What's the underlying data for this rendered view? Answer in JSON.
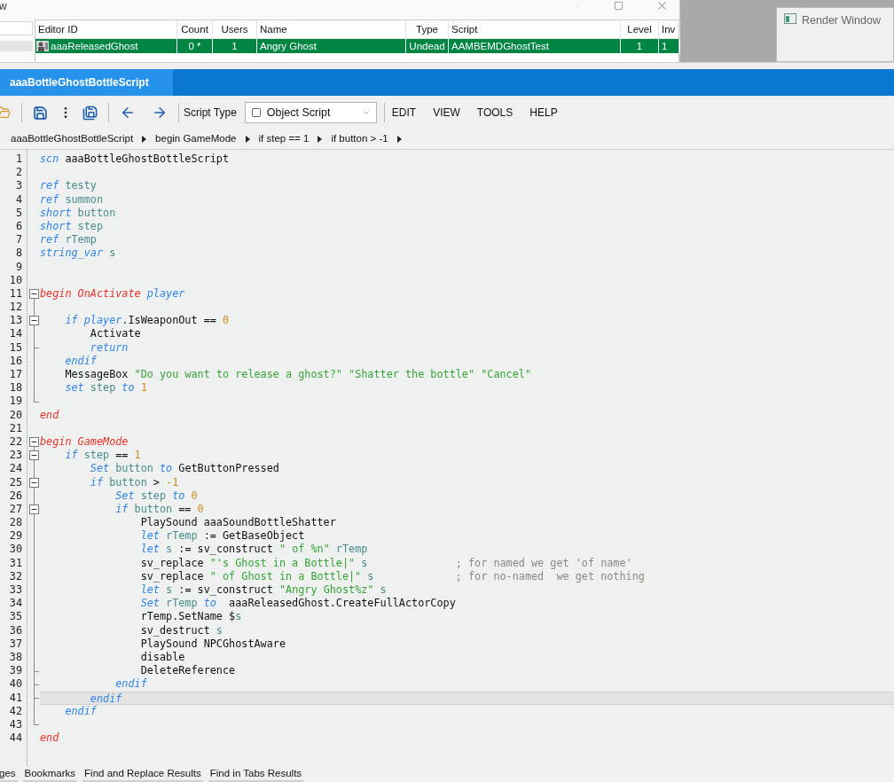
{
  "background_window": {
    "title": "w",
    "columns": [
      "Editor ID",
      "Count",
      "Users",
      "Name",
      "Type",
      "Script",
      "Level",
      "Inv"
    ],
    "rows": [
      {
        "selected": true,
        "cells": [
          "aaaReleasedGhost",
          "0 *",
          "1",
          "Angry Ghost",
          "Undead",
          "AAMBEMDGhostTest",
          "1",
          "1"
        ]
      }
    ]
  },
  "render_window": {
    "title": "Render Window"
  },
  "editor": {
    "tabs": [
      {
        "label": "aaaBottleGhostBottleScript",
        "selected": true
      }
    ],
    "toolbar": {
      "script_type_label": "Script Type",
      "script_type": "Object Script",
      "menus": [
        "EDIT",
        "VIEW",
        "TOOLS",
        "HELP"
      ]
    },
    "breadcrumb": [
      "aaaBottleGhostBottleScript",
      "begin GameMode",
      "if step == 1",
      "if button > -1"
    ],
    "lines": [
      {
        "number": "1",
        "kind": "none",
        "current": false,
        "tokens": [
          {
            "kind": "keyword",
            "text": "scn"
          },
          {
            "kind": "text",
            "text": " aaaBottleGhostBottleScript"
          }
        ]
      },
      {
        "number": "2",
        "kind": "none",
        "current": false
      },
      {
        "number": "3",
        "kind": "none",
        "current": false,
        "tokens": [
          {
            "kind": "keyword",
            "text": "ref"
          },
          {
            "kind": "variable",
            "text": " testy"
          }
        ]
      },
      {
        "number": "4",
        "kind": "none",
        "current": false,
        "tokens": [
          {
            "kind": "keyword",
            "text": "ref"
          },
          {
            "kind": "variable",
            "text": " summon"
          }
        ]
      },
      {
        "number": "5",
        "kind": "none",
        "current": false,
        "tokens": [
          {
            "kind": "keyword",
            "text": "short"
          },
          {
            "kind": "variable",
            "text": " button"
          }
        ]
      },
      {
        "number": "6",
        "kind": "none",
        "current": false,
        "tokens": [
          {
            "kind": "keyword",
            "text": "short"
          },
          {
            "kind": "variable",
            "text": " step"
          }
        ]
      },
      {
        "number": "7",
        "kind": "none",
        "current": false,
        "tokens": [
          {
            "kind": "keyword",
            "text": "ref"
          },
          {
            "kind": "variable",
            "text": " rTemp"
          }
        ]
      },
      {
        "number": "8",
        "kind": "none",
        "current": false,
        "tokens": [
          {
            "kind": "keyword",
            "text": "string_var"
          },
          {
            "kind": "variable",
            "text": " s"
          }
        ]
      },
      {
        "number": "9",
        "kind": "none",
        "current": false
      },
      {
        "number": "10",
        "kind": "none",
        "current": false
      },
      {
        "number": "11",
        "kind": "start",
        "current": false,
        "tokens": [
          {
            "kind": "block",
            "text": "begin OnActivate"
          },
          {
            "kind": "keyword",
            "text": " player"
          }
        ]
      },
      {
        "number": "12",
        "kind": "inner",
        "current": false
      },
      {
        "number": "13",
        "kind": "open",
        "current": false,
        "tokens": [
          {
            "kind": "keyword",
            "text": "    if player"
          },
          {
            "kind": "text",
            "text": ".IsWeaponOut == "
          },
          {
            "kind": "number",
            "text": "0"
          }
        ]
      },
      {
        "number": "14",
        "kind": "inner",
        "current": false,
        "tokens": [
          {
            "kind": "text",
            "text": "        Activate"
          }
        ]
      },
      {
        "number": "15",
        "kind": "branch",
        "current": false,
        "tokens": [
          {
            "kind": "keyword",
            "text": "        return"
          }
        ]
      },
      {
        "number": "16",
        "kind": "inner",
        "current": false,
        "tokens": [
          {
            "kind": "keyword",
            "text": "    endif"
          }
        ]
      },
      {
        "number": "17",
        "kind": "inner",
        "current": false,
        "tokens": [
          {
            "kind": "text",
            "text": "    MessageBox "
          },
          {
            "kind": "string",
            "text": "\"Do you want to release a ghost?\" \"Shatter the bottle\" \"Cancel\""
          }
        ]
      },
      {
        "number": "18",
        "kind": "inner",
        "current": false,
        "tokens": [
          {
            "kind": "keyword",
            "text": "    set"
          },
          {
            "kind": "variable",
            "text": " step"
          },
          {
            "kind": "keyword",
            "text": " to"
          },
          {
            "kind": "number",
            "text": " 1"
          }
        ]
      },
      {
        "number": "19",
        "kind": "close",
        "current": false
      },
      {
        "number": "20",
        "kind": "none",
        "current": false,
        "tokens": [
          {
            "kind": "block",
            "text": "end"
          }
        ]
      },
      {
        "number": "21",
        "kind": "none",
        "current": false
      },
      {
        "number": "22",
        "kind": "start",
        "current": false,
        "tokens": [
          {
            "kind": "block",
            "text": "begin GameMode"
          }
        ]
      },
      {
        "number": "23",
        "kind": "open",
        "current": false,
        "tokens": [
          {
            "kind": "keyword",
            "text": "    if"
          },
          {
            "kind": "variable",
            "text": " step"
          },
          {
            "kind": "text",
            "text": " == "
          },
          {
            "kind": "number",
            "text": "1"
          }
        ]
      },
      {
        "number": "24",
        "kind": "inner",
        "current": false,
        "tokens": [
          {
            "kind": "keyword",
            "text": "        Set"
          },
          {
            "kind": "variable",
            "text": " button"
          },
          {
            "kind": "keyword",
            "text": " to"
          },
          {
            "kind": "text",
            "text": " GetButtonPressed"
          }
        ]
      },
      {
        "number": "25",
        "kind": "open",
        "current": false,
        "tokens": [
          {
            "kind": "keyword",
            "text": "        if"
          },
          {
            "kind": "variable",
            "text": " button"
          },
          {
            "kind": "text",
            "text": " > "
          },
          {
            "kind": "number",
            "text": "-1"
          }
        ]
      },
      {
        "number": "26",
        "kind": "inner",
        "current": false,
        "tokens": [
          {
            "kind": "keyword",
            "text": "            Set"
          },
          {
            "kind": "variable",
            "text": " step"
          },
          {
            "kind": "keyword",
            "text": " to"
          },
          {
            "kind": "number",
            "text": " 0"
          }
        ]
      },
      {
        "number": "27",
        "kind": "open",
        "current": false,
        "tokens": [
          {
            "kind": "keyword",
            "text": "            if"
          },
          {
            "kind": "variable",
            "text": " button"
          },
          {
            "kind": "text",
            "text": " == "
          },
          {
            "kind": "number",
            "text": "0"
          }
        ]
      },
      {
        "number": "28",
        "kind": "inner",
        "current": false,
        "tokens": [
          {
            "kind": "text",
            "text": "                PlaySound aaaSoundBottleShatter"
          }
        ]
      },
      {
        "number": "29",
        "kind": "inner",
        "current": false,
        "tokens": [
          {
            "kind": "keyword",
            "text": "                let"
          },
          {
            "kind": "variable",
            "text": " rTemp"
          },
          {
            "kind": "text",
            "text": " := GetBaseObject"
          }
        ]
      },
      {
        "number": "30",
        "kind": "inner",
        "current": false,
        "tokens": [
          {
            "kind": "keyword",
            "text": "                let"
          },
          {
            "kind": "variable",
            "text": " s"
          },
          {
            "kind": "text",
            "text": " := sv_construct "
          },
          {
            "kind": "string",
            "text": "\" of %n\""
          },
          {
            "kind": "variable",
            "text": " rTemp"
          }
        ]
      },
      {
        "number": "31",
        "kind": "inner",
        "current": false,
        "tokens": [
          {
            "kind": "text",
            "text": "                sv_replace "
          },
          {
            "kind": "string",
            "text": "\"'s Ghost in a Bottle|\""
          },
          {
            "kind": "variable",
            "text": " s"
          },
          {
            "kind": "comment",
            "text": "              ; for named we get 'of name'"
          }
        ]
      },
      {
        "number": "32",
        "kind": "inner",
        "current": false,
        "tokens": [
          {
            "kind": "text",
            "text": "                sv_replace "
          },
          {
            "kind": "string",
            "text": "\" of Ghost in a Bottle|\""
          },
          {
            "kind": "variable",
            "text": " s"
          },
          {
            "kind": "comment",
            "text": "             ; for no-named  we get nothing"
          }
        ]
      },
      {
        "number": "33",
        "kind": "inner",
        "current": false,
        "tokens": [
          {
            "kind": "keyword",
            "text": "                let"
          },
          {
            "kind": "variable",
            "text": " s"
          },
          {
            "kind": "text",
            "text": " := sv_construct "
          },
          {
            "kind": "string",
            "text": "\"Angry Ghost%z\""
          },
          {
            "kind": "variable",
            "text": " s"
          }
        ]
      },
      {
        "number": "34",
        "kind": "inner",
        "current": false,
        "tokens": [
          {
            "kind": "keyword",
            "text": "                Set"
          },
          {
            "kind": "variable",
            "text": " rTemp"
          },
          {
            "kind": "keyword",
            "text": " to"
          },
          {
            "kind": "text",
            "text": "  aaaReleasedGhost.CreateFullActorCopy"
          }
        ]
      },
      {
        "number": "35",
        "kind": "inner",
        "current": false,
        "tokens": [
          {
            "kind": "text",
            "text": "                rTemp.SetName $"
          },
          {
            "kind": "variable",
            "text": "s"
          }
        ]
      },
      {
        "number": "36",
        "kind": "inner",
        "current": false,
        "tokens": [
          {
            "kind": "text",
            "text": "                sv_destruct"
          },
          {
            "kind": "variable",
            "text": " s"
          }
        ]
      },
      {
        "number": "37",
        "kind": "inner",
        "current": false,
        "tokens": [
          {
            "kind": "text",
            "text": "                PlaySound NPCGhostAware"
          }
        ]
      },
      {
        "number": "38",
        "kind": "inner",
        "current": false,
        "tokens": [
          {
            "kind": "text",
            "text": "                disable"
          }
        ]
      },
      {
        "number": "39",
        "kind": "branch",
        "current": false,
        "tokens": [
          {
            "kind": "text",
            "text": "                DeleteReference"
          }
        ]
      },
      {
        "number": "40",
        "kind": "branch",
        "current": false,
        "tokens": [
          {
            "kind": "keyword",
            "text": "            endif"
          }
        ]
      },
      {
        "number": "41",
        "kind": "branch",
        "current": true,
        "tokens": [
          {
            "kind": "keyword",
            "text": "        endif"
          }
        ]
      },
      {
        "number": "42",
        "kind": "inner",
        "current": false,
        "tokens": [
          {
            "kind": "keyword",
            "text": "    endif"
          }
        ]
      },
      {
        "number": "43",
        "kind": "close",
        "current": false
      },
      {
        "number": "44",
        "kind": "none",
        "current": false,
        "tokens": [
          {
            "kind": "block",
            "text": "end"
          }
        ]
      }
    ],
    "bottom_tabs": [
      "ges",
      "Bookmarks",
      "Find and Replace Results",
      "Find in Tabs Results"
    ]
  }
}
